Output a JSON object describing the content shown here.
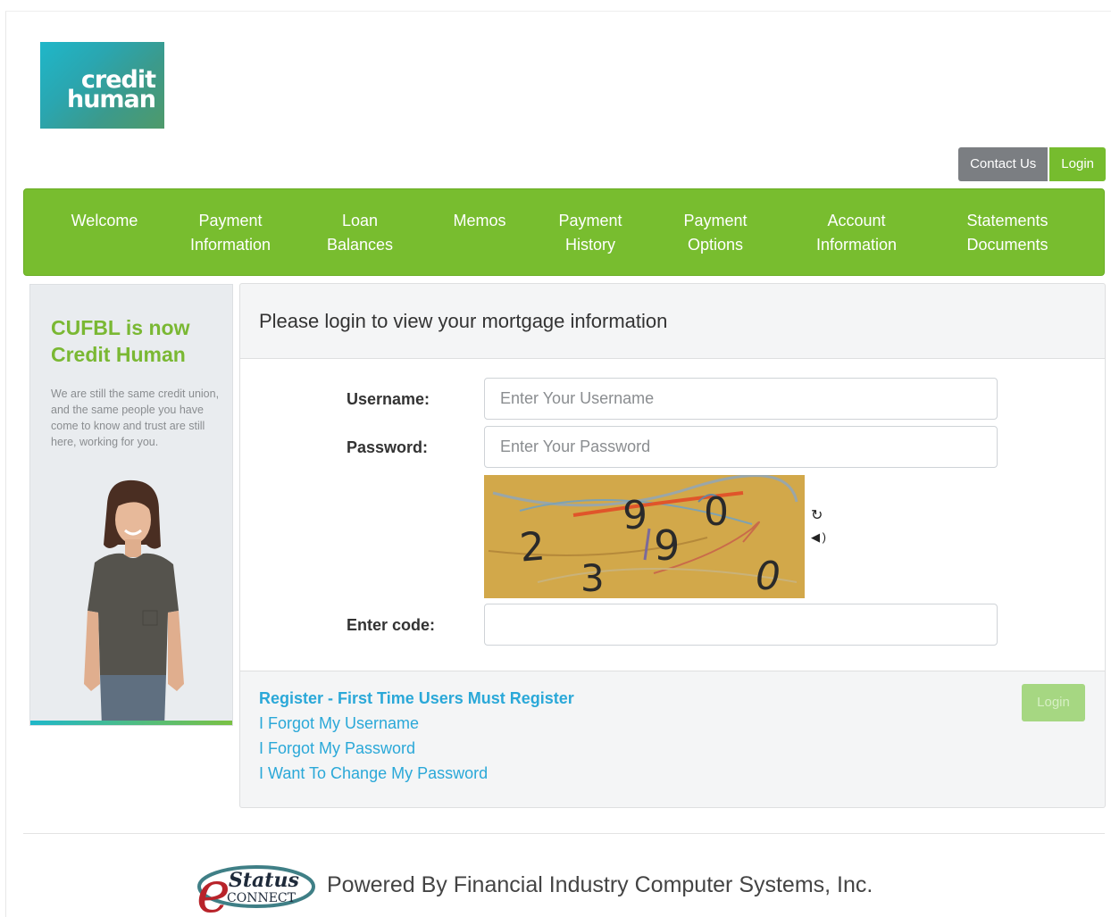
{
  "brand": {
    "logo_line1": "credit",
    "logo_line2": "human",
    "logo_color_a": "#1fb7c9",
    "logo_color_b": "#4f9a6a"
  },
  "top_buttons": {
    "contact": "Contact Us",
    "login": "Login"
  },
  "nav": {
    "items": [
      {
        "line1": "Welcome",
        "line2": ""
      },
      {
        "line1": "Payment",
        "line2": "Information"
      },
      {
        "line1": "Loan",
        "line2": "Balances"
      },
      {
        "line1": "Memos",
        "line2": ""
      },
      {
        "line1": "Payment",
        "line2": "History"
      },
      {
        "line1": "Payment",
        "line2": "Options"
      },
      {
        "line1": "Account",
        "line2": "Information"
      },
      {
        "line1": "Statements",
        "line2": "Documents"
      }
    ],
    "color": "#78bd2f"
  },
  "promo": {
    "title_line1": "CUFBL is now",
    "title_line2": "Credit Human",
    "text": "We are still the same credit union, and the same people you have come to know and trust are still here, working for you."
  },
  "login": {
    "heading": "Please login to view your mortgage information",
    "username_label": "Username:",
    "username_placeholder": "Enter Your Username",
    "password_label": "Password:",
    "password_placeholder": "Enter Your Password",
    "code_label": "Enter code:",
    "code_value": "",
    "captcha_chars": [
      "2",
      "3",
      "9",
      "9",
      "0",
      "0"
    ],
    "button": "Login"
  },
  "links": {
    "register": "Register - First Time Users Must Register",
    "forgot_username": "I Forgot My Username",
    "forgot_password": "I Forgot My Password",
    "change_password": "I Want To Change My Password"
  },
  "footer": {
    "logo_word1": "Status",
    "logo_word2": "CONNECT",
    "logo_letter": "e",
    "powered_by": "Powered By Financial Industry Computer Systems, Inc."
  }
}
